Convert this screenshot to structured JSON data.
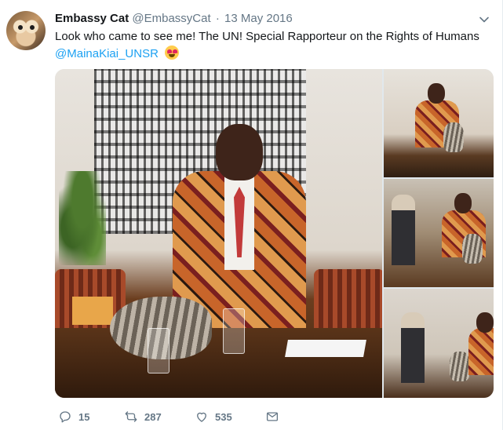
{
  "tweet": {
    "author_name": "Embassy Cat",
    "author_handle": "@EmbassyCat",
    "separator": "·",
    "date": "13 May 2016",
    "text": "Look who came to see me! The UN! Special Rapporteur on the Rights of Humans",
    "mention": "@MainaKiai_UNSR",
    "emoji": "heart-eyes-emoji",
    "photos": [
      {
        "name": "main-photo",
        "caption": ""
      },
      {
        "name": "thumb-photo-1",
        "caption": ""
      },
      {
        "name": "thumb-photo-2",
        "caption": ""
      },
      {
        "name": "thumb-photo-3",
        "caption": ""
      }
    ]
  },
  "actions": {
    "reply_count": "15",
    "retweet_count": "287",
    "like_count": "535"
  },
  "colors": {
    "name": "#14171a",
    "secondary": "#657786",
    "link": "#1da1f2",
    "divider": "#e6ecf0"
  },
  "icons": {
    "caret": "chevron-down-icon",
    "reply": "reply-icon",
    "retweet": "retweet-icon",
    "like": "heart-icon",
    "dm": "envelope-icon"
  }
}
